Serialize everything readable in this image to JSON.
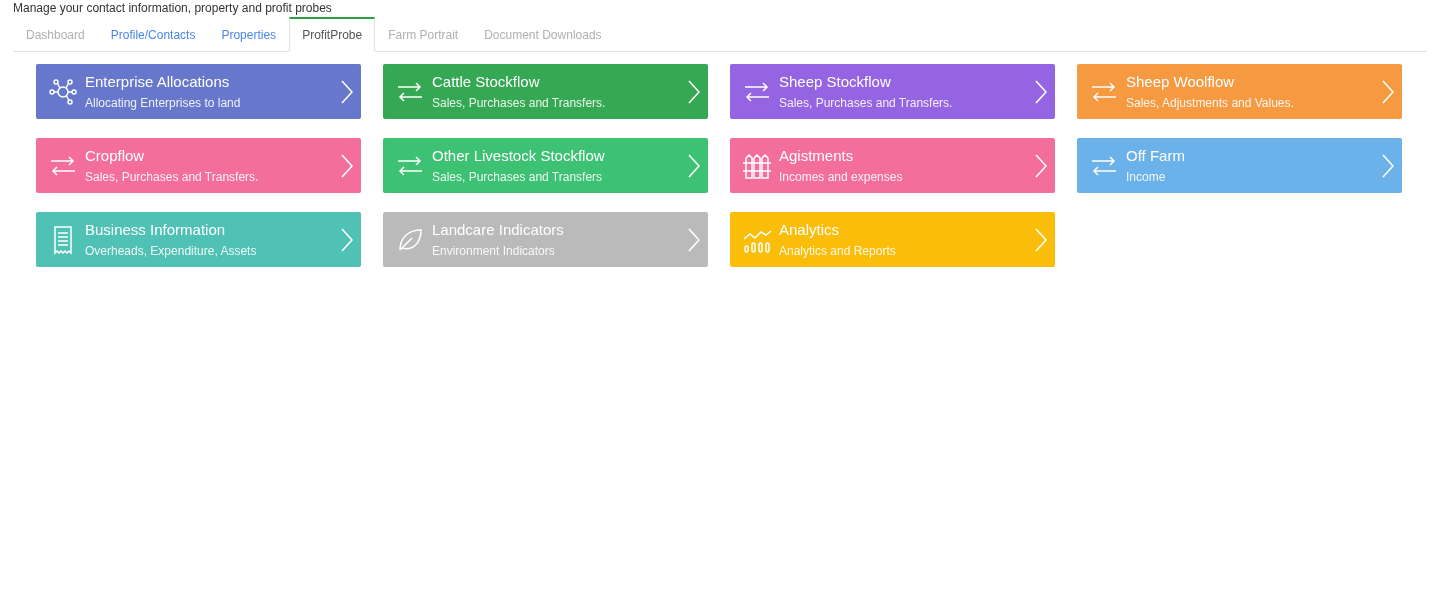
{
  "subtitle": "Manage your contact information, property and profit probes",
  "tabs": [
    {
      "label": "Dashboard",
      "selected": false,
      "disabled": true
    },
    {
      "label": "Profile/Contacts",
      "selected": false,
      "disabled": false
    },
    {
      "label": "Properties",
      "selected": false,
      "disabled": false
    },
    {
      "label": "ProfitProbe",
      "selected": true,
      "disabled": false
    },
    {
      "label": "Farm Portrait",
      "selected": false,
      "disabled": true
    },
    {
      "label": "Document Downloads",
      "selected": false,
      "disabled": true
    }
  ],
  "cards": [
    {
      "title": "Enterprise Allocations",
      "subtitle": "Allocating Enterprises to land",
      "color": "#6677cc",
      "kind": "network"
    },
    {
      "title": "Cattle Stockflow",
      "subtitle": "Sales, Purchases and Transfers.",
      "color": "#34a853",
      "kind": "transfer"
    },
    {
      "title": "Sheep Stockflow",
      "subtitle": "Sales, Purchases and Transfers.",
      "color": "#9464e2",
      "kind": "transfer"
    },
    {
      "title": "Sheep Woolflow",
      "subtitle": "Sales, Adjustments and Values.",
      "color": "#f59a40",
      "kind": "transfer"
    },
    {
      "title": "Cropflow",
      "subtitle": "Sales, Purchases and Transfers.",
      "color": "#f46e9b",
      "kind": "transfer"
    },
    {
      "title": "Other Livestock Stockflow",
      "subtitle": "Sales, Purchases and Transfers",
      "color": "#3cc272",
      "kind": "transfer"
    },
    {
      "title": "Agistments",
      "subtitle": "Incomes and expenses",
      "color": "#f46e9b",
      "kind": "fence"
    },
    {
      "title": "Off Farm",
      "subtitle": "Income",
      "color": "#6bb2ea",
      "kind": "transfer"
    },
    {
      "title": "Business Information",
      "subtitle": "Overheads, Expenditure, Assets",
      "color": "#4fc1b5",
      "kind": "receipt"
    },
    {
      "title": "Landcare Indicators",
      "subtitle": "Environment Indicators",
      "color": "#bababa",
      "kind": "leaf"
    },
    {
      "title": "Analytics",
      "subtitle": "Analytics and Reports",
      "color": "#fabd0a",
      "kind": "chart"
    }
  ]
}
